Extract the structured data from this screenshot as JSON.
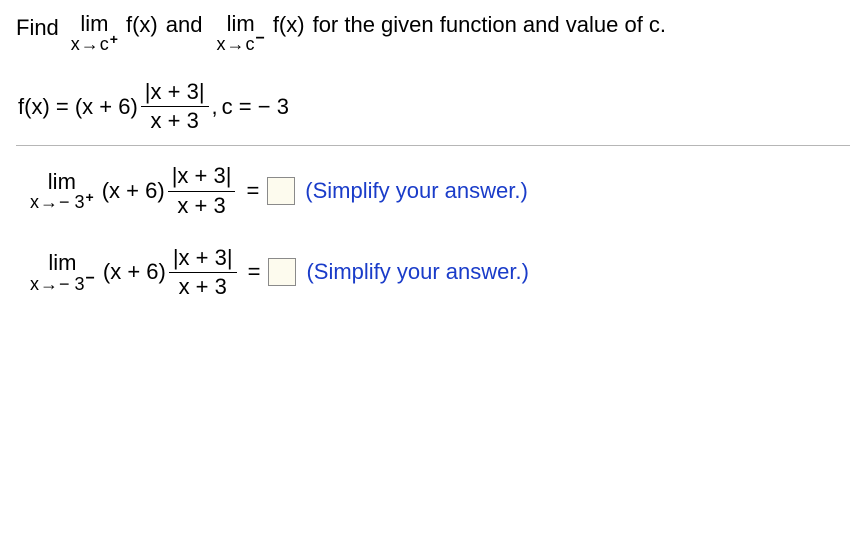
{
  "prompt": {
    "lead": "Find",
    "lim_word": "lim",
    "arrow": "→",
    "var": "x",
    "c_sym": "c",
    "sup_plus": "+",
    "sup_minus": "−",
    "fx": "f(x)",
    "and": "and",
    "tail": "for the given function and value of c."
  },
  "defn": {
    "lhs": "f(x) = (x + 6)",
    "num": "|x + 3|",
    "den": "x + 3",
    "comma": ",",
    "c_eq": "c = − 3"
  },
  "ans": {
    "lim_word": "lim",
    "arrow": "→",
    "var": "x",
    "target_plus": "− 3",
    "sup_plus": "+",
    "target_minus": "− 3",
    "sup_minus": "−",
    "body_pre": "(x + 6)",
    "num": "|x + 3|",
    "den": "x + 3",
    "eq": "=",
    "hint": "(Simplify your answer.)"
  }
}
